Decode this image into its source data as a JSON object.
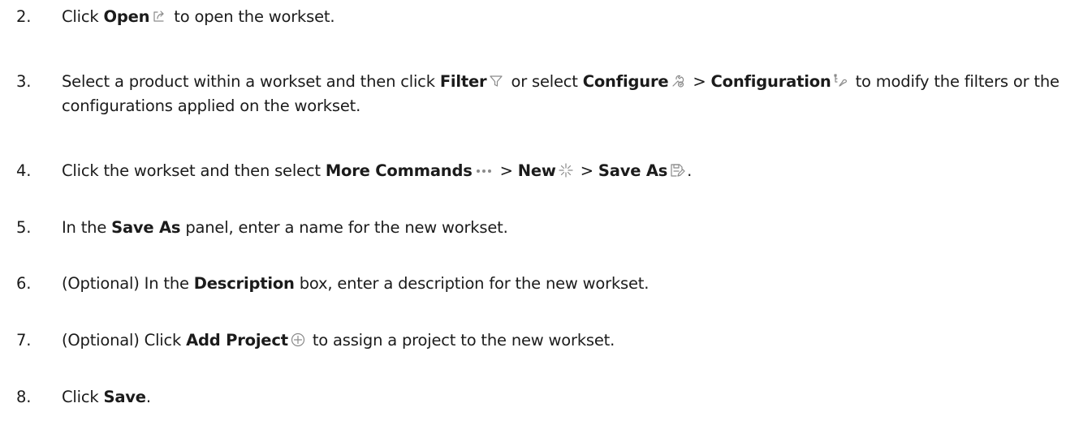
{
  "steps": [
    {
      "number": "2.",
      "parts": [
        {
          "t": "Click "
        },
        {
          "t": "Open",
          "b": true
        },
        {
          "icon": "open-icon"
        },
        {
          "t": " to open the workset."
        }
      ]
    },
    {
      "number": "3.",
      "parts": [
        {
          "t": "Select a product within a workset and then click "
        },
        {
          "t": "Filter",
          "b": true
        },
        {
          "icon": "filter-icon"
        },
        {
          "t": " or select "
        },
        {
          "t": "Configure",
          "b": true
        },
        {
          "icon": "configure-icon"
        },
        {
          "t": " > "
        },
        {
          "t": "Configuration",
          "b": true
        },
        {
          "icon": "configuration-icon"
        },
        {
          "t": " to modify the filters or the configurations applied on the workset."
        }
      ]
    },
    {
      "number": "4.",
      "parts": [
        {
          "t": "Click the workset and then select "
        },
        {
          "t": "More Commands",
          "b": true
        },
        {
          "icon": "more-commands-icon"
        },
        {
          "t": " > "
        },
        {
          "t": "New",
          "b": true
        },
        {
          "icon": "new-icon"
        },
        {
          "t": " > "
        },
        {
          "t": "Save As",
          "b": true
        },
        {
          "icon": "save-as-icon"
        },
        {
          "t": "."
        }
      ]
    },
    {
      "number": "5.",
      "parts": [
        {
          "t": "In the "
        },
        {
          "t": "Save As",
          "b": true
        },
        {
          "t": " panel, enter a name for the new workset."
        }
      ]
    },
    {
      "number": "6.",
      "parts": [
        {
          "t": "(Optional) In the "
        },
        {
          "t": "Description",
          "b": true
        },
        {
          "t": " box, enter a description for the new workset."
        }
      ]
    },
    {
      "number": "7.",
      "parts": [
        {
          "t": "(Optional) Click "
        },
        {
          "t": "Add Project",
          "b": true
        },
        {
          "icon": "add-project-icon"
        },
        {
          "t": " to assign a project to the new workset."
        }
      ]
    },
    {
      "number": "8.",
      "parts": [
        {
          "t": "Click "
        },
        {
          "t": "Save",
          "b": true
        },
        {
          "t": "."
        }
      ]
    }
  ]
}
